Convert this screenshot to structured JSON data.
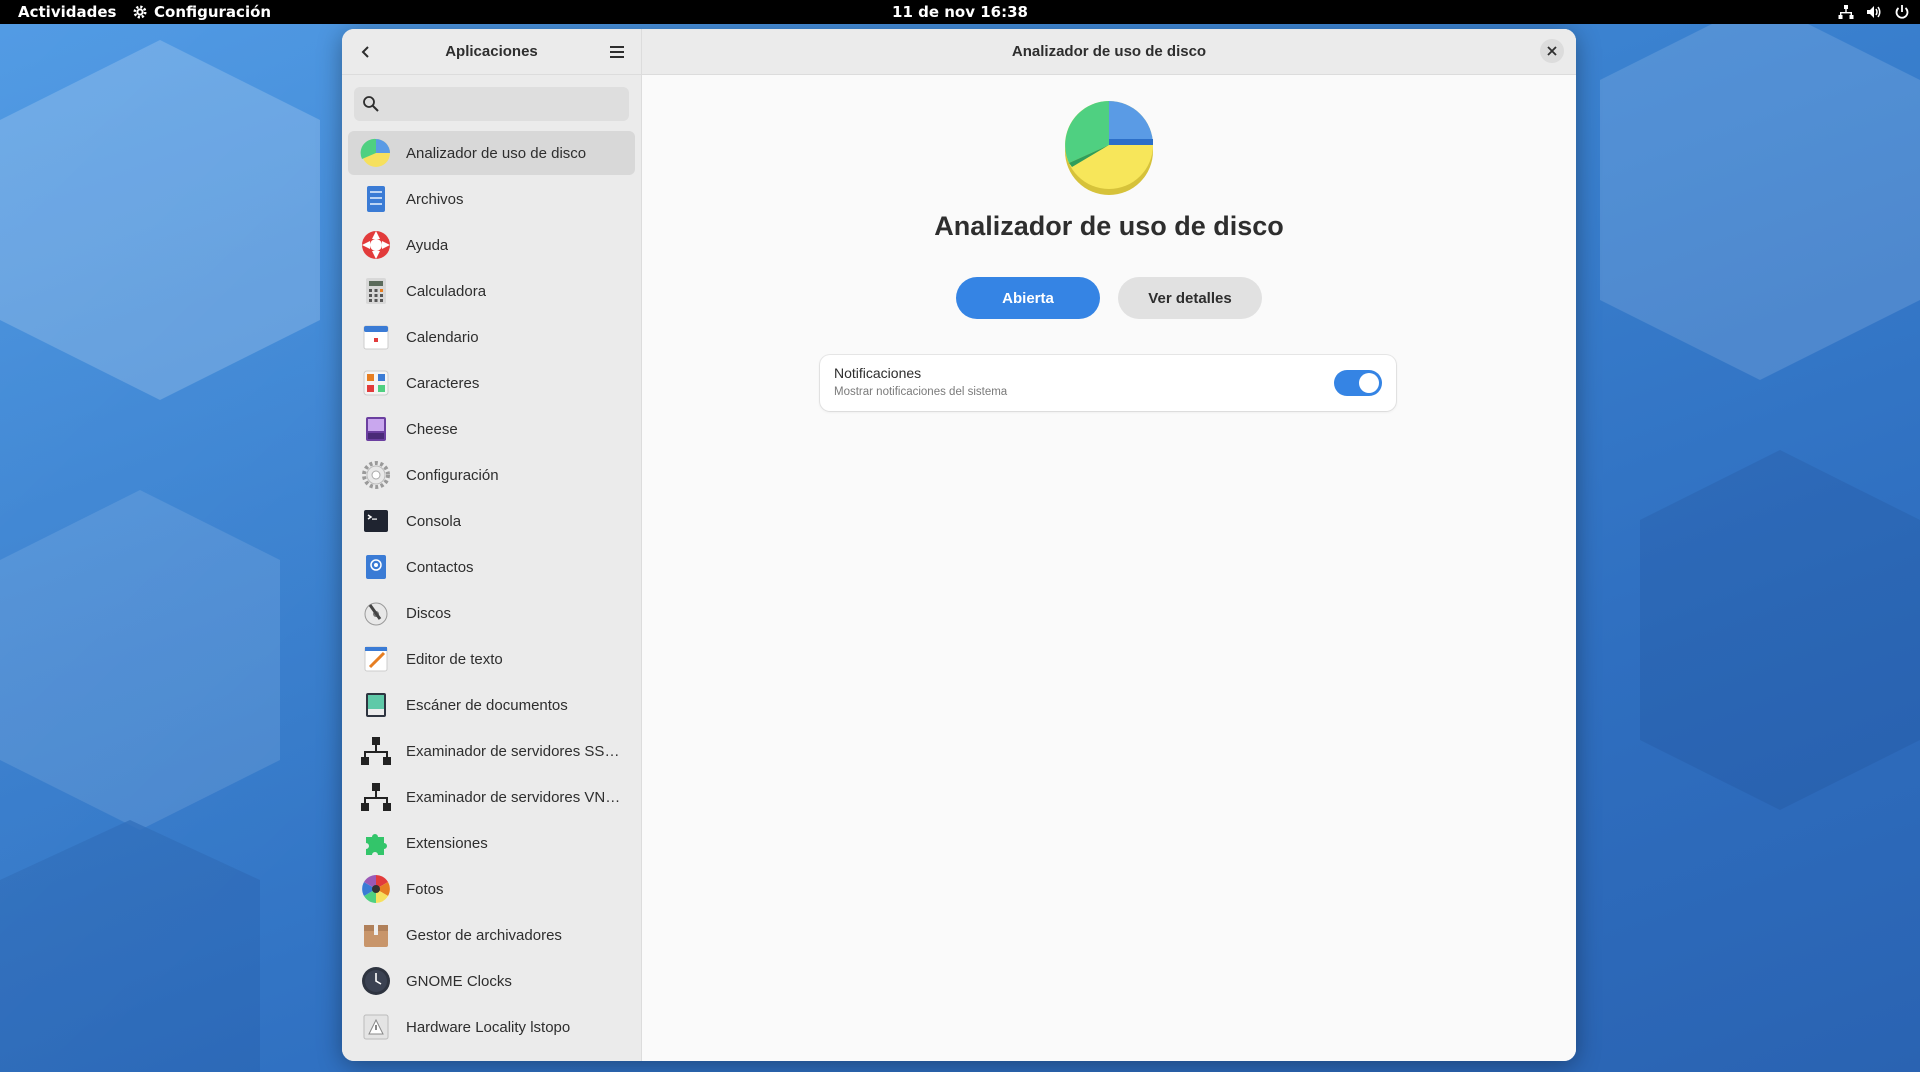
{
  "topbar": {
    "activities": "Actividades",
    "app_name": "Configuración",
    "clock": "11 de nov  16:38"
  },
  "sidebar": {
    "title": "Aplicaciones",
    "search_placeholder": "",
    "items": [
      {
        "label": "Analizador de uso de disco",
        "icon": "disk-usage-icon",
        "selected": true
      },
      {
        "label": "Archivos",
        "icon": "files-icon"
      },
      {
        "label": "Ayuda",
        "icon": "help-icon"
      },
      {
        "label": "Calculadora",
        "icon": "calculator-icon"
      },
      {
        "label": "Calendario",
        "icon": "calendar-icon"
      },
      {
        "label": "Caracteres",
        "icon": "characters-icon"
      },
      {
        "label": "Cheese",
        "icon": "cheese-icon"
      },
      {
        "label": "Configuración",
        "icon": "settings-icon"
      },
      {
        "label": "Consola",
        "icon": "console-icon"
      },
      {
        "label": "Contactos",
        "icon": "contacts-icon"
      },
      {
        "label": "Discos",
        "icon": "disks-icon"
      },
      {
        "label": "Editor de texto",
        "icon": "text-editor-icon"
      },
      {
        "label": "Escáner de documentos",
        "icon": "scanner-icon"
      },
      {
        "label": "Examinador de servidores SSH…",
        "icon": "network-icon"
      },
      {
        "label": "Examinador de servidores VNC…",
        "icon": "network-icon"
      },
      {
        "label": "Extensiones",
        "icon": "extensions-icon"
      },
      {
        "label": "Fotos",
        "icon": "photos-icon"
      },
      {
        "label": "Gestor de archivadores",
        "icon": "archive-icon"
      },
      {
        "label": "GNOME Clocks",
        "icon": "clocks-icon"
      },
      {
        "label": "Hardware Locality lstopo",
        "icon": "lstopo-icon"
      }
    ]
  },
  "main": {
    "title": "Analizador de uso de disco",
    "app_name": "Analizador de uso de disco",
    "open_label": "Abierta",
    "details_label": "Ver detalles",
    "notifications": {
      "title": "Notificaciones",
      "subtitle": "Mostrar notificaciones del sistema",
      "enabled": true
    }
  },
  "colors": {
    "accent": "#3584e4",
    "desktop": "#3d86d6"
  }
}
